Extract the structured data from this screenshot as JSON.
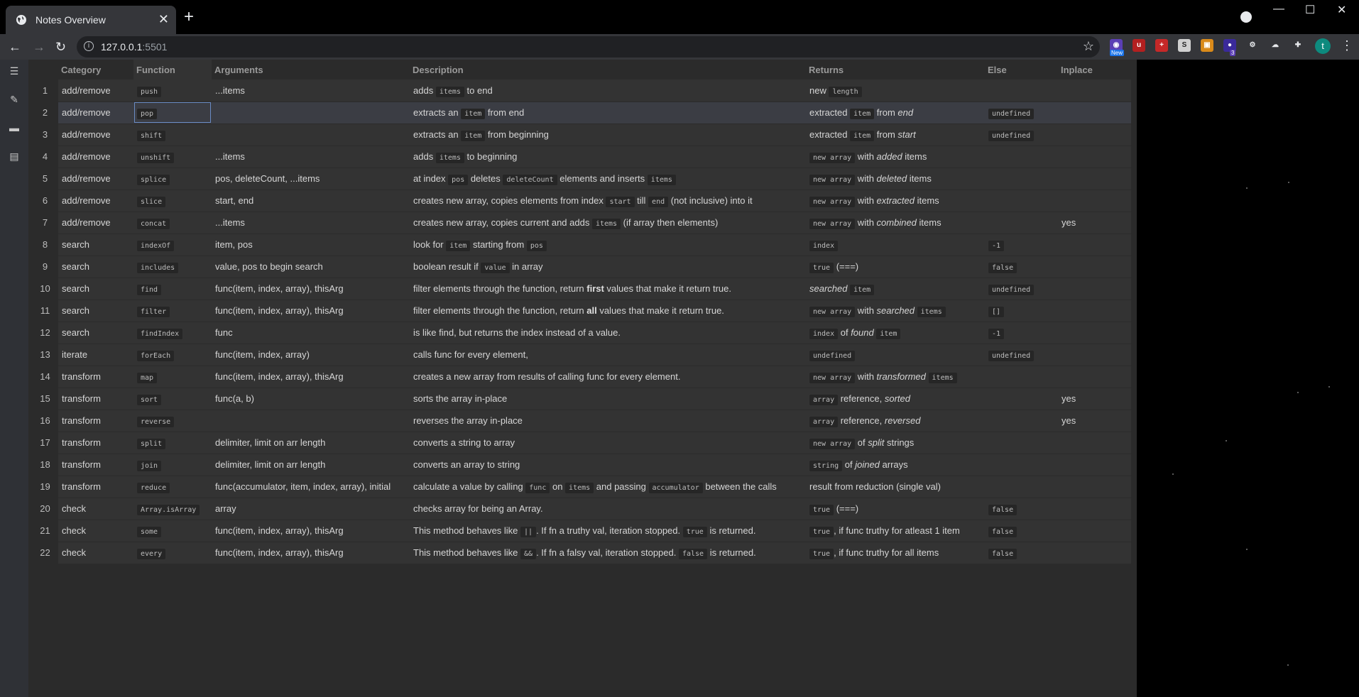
{
  "browser": {
    "tab_title": "Notes Overview",
    "url_host": "127.0.0.1",
    "url_port": ":5501",
    "ext_new_badge": "New",
    "ext_count_badge": "3",
    "profile_initial": "t"
  },
  "table": {
    "headers": [
      "Category",
      "Function",
      "Arguments",
      "Description",
      "Returns",
      "Else",
      "Inplace"
    ],
    "rows": [
      {
        "n": "1",
        "cat": "add/remove",
        "fn": "push",
        "args": "...items",
        "desc": [
          {
            "t": "adds "
          },
          {
            "c": "items"
          },
          {
            "t": " to end"
          }
        ],
        "ret": [
          {
            "t": "new "
          },
          {
            "c": "length"
          }
        ],
        "else": [],
        "inplace": ""
      },
      {
        "n": "2",
        "cat": "add/remove",
        "fn": "pop",
        "args": "",
        "desc": [
          {
            "t": "extracts an "
          },
          {
            "c": "item"
          },
          {
            "t": " from end"
          }
        ],
        "ret": [
          {
            "t": "extracted "
          },
          {
            "c": "item"
          },
          {
            "t": " from "
          },
          {
            "i": "end"
          }
        ],
        "else": [
          {
            "c": "undefined"
          }
        ],
        "inplace": ""
      },
      {
        "n": "3",
        "cat": "add/remove",
        "fn": "shift",
        "args": "",
        "desc": [
          {
            "t": "extracts an "
          },
          {
            "c": "item"
          },
          {
            "t": " from beginning"
          }
        ],
        "ret": [
          {
            "t": "extracted "
          },
          {
            "c": "item"
          },
          {
            "t": " from "
          },
          {
            "i": "start"
          }
        ],
        "else": [
          {
            "c": "undefined"
          }
        ],
        "inplace": ""
      },
      {
        "n": "4",
        "cat": "add/remove",
        "fn": "unshift",
        "args": "...items",
        "desc": [
          {
            "t": "adds "
          },
          {
            "c": "items"
          },
          {
            "t": " to beginning"
          }
        ],
        "ret": [
          {
            "c": "new array"
          },
          {
            "t": " with "
          },
          {
            "i": "added"
          },
          {
            "t": " items"
          }
        ],
        "else": [],
        "inplace": ""
      },
      {
        "n": "5",
        "cat": "add/remove",
        "fn": "splice",
        "args": "pos, deleteCount, ...items",
        "desc": [
          {
            "t": "at index "
          },
          {
            "c": "pos"
          },
          {
            "t": " deletes "
          },
          {
            "c": "deleteCount"
          },
          {
            "t": " elements and inserts "
          },
          {
            "c": "items"
          }
        ],
        "ret": [
          {
            "c": "new array"
          },
          {
            "t": " with "
          },
          {
            "i": "deleted"
          },
          {
            "t": " items"
          }
        ],
        "else": [],
        "inplace": ""
      },
      {
        "n": "6",
        "cat": "add/remove",
        "fn": "slice",
        "args": "start, end",
        "desc": [
          {
            "t": "creates new array, copies elements from index "
          },
          {
            "c": "start"
          },
          {
            "t": " till "
          },
          {
            "c": "end"
          },
          {
            "t": " (not inclusive) into it"
          }
        ],
        "ret": [
          {
            "c": "new array"
          },
          {
            "t": " with "
          },
          {
            "i": "extracted"
          },
          {
            "t": " items"
          }
        ],
        "else": [],
        "inplace": ""
      },
      {
        "n": "7",
        "cat": "add/remove",
        "fn": "concat",
        "args": "...items",
        "desc": [
          {
            "t": "creates new array, copies current and adds "
          },
          {
            "c": "items"
          },
          {
            "t": " (if array then elements)"
          }
        ],
        "ret": [
          {
            "c": "new array"
          },
          {
            "t": " with "
          },
          {
            "i": "combined"
          },
          {
            "t": " items"
          }
        ],
        "else": [],
        "inplace": "yes"
      },
      {
        "n": "8",
        "cat": "search",
        "fn": "indexOf",
        "args": "item, pos",
        "desc": [
          {
            "t": "look for "
          },
          {
            "c": "item"
          },
          {
            "t": " starting from "
          },
          {
            "c": "pos"
          }
        ],
        "ret": [
          {
            "c": "index"
          }
        ],
        "else": [
          {
            "c": "-1"
          }
        ],
        "inplace": ""
      },
      {
        "n": "9",
        "cat": "search",
        "fn": "includes",
        "args": "value, pos to begin search",
        "desc": [
          {
            "t": "boolean result if "
          },
          {
            "c": "value"
          },
          {
            "t": " in array"
          }
        ],
        "ret": [
          {
            "c": "true"
          },
          {
            "t": " (===)"
          }
        ],
        "else": [
          {
            "c": "false"
          }
        ],
        "inplace": ""
      },
      {
        "n": "10",
        "cat": "search",
        "fn": "find",
        "args": "func(item, index, array), thisArg",
        "desc": [
          {
            "t": "filter elements through the function, return "
          },
          {
            "b": "first"
          },
          {
            "t": " values that make it return true."
          }
        ],
        "ret": [
          {
            "i": "searched"
          },
          {
            "t": " "
          },
          {
            "c": "item"
          }
        ],
        "else": [
          {
            "c": "undefined"
          }
        ],
        "inplace": ""
      },
      {
        "n": "11",
        "cat": "search",
        "fn": "filter",
        "args": "func(item, index, array), thisArg",
        "desc": [
          {
            "t": "filter elements through the function, return "
          },
          {
            "b": "all"
          },
          {
            "t": " values that make it return true."
          }
        ],
        "ret": [
          {
            "c": "new array"
          },
          {
            "t": " with "
          },
          {
            "i": "searched"
          },
          {
            "t": " "
          },
          {
            "c": "items"
          }
        ],
        "else": [
          {
            "c": "[]"
          }
        ],
        "inplace": ""
      },
      {
        "n": "12",
        "cat": "search",
        "fn": "findIndex",
        "args": "func",
        "desc": [
          {
            "t": "is like find, but returns the index instead of a value."
          }
        ],
        "ret": [
          {
            "c": "index"
          },
          {
            "t": " of "
          },
          {
            "i": "found"
          },
          {
            "t": " "
          },
          {
            "c": "item"
          }
        ],
        "else": [
          {
            "c": "-1"
          }
        ],
        "inplace": ""
      },
      {
        "n": "13",
        "cat": "iterate",
        "fn": "forEach",
        "args": "func(item, index, array)",
        "desc": [
          {
            "t": "calls func for every element,"
          }
        ],
        "ret": [
          {
            "c": "undefined"
          }
        ],
        "else": [
          {
            "c": "undefined"
          }
        ],
        "inplace": ""
      },
      {
        "n": "14",
        "cat": "transform",
        "fn": "map",
        "args": "func(item, index, array), thisArg",
        "desc": [
          {
            "t": "creates a new array from results of calling func for every element."
          }
        ],
        "ret": [
          {
            "c": "new array"
          },
          {
            "t": " with "
          },
          {
            "i": "transformed"
          },
          {
            "t": " "
          },
          {
            "c": "items"
          }
        ],
        "else": [],
        "inplace": ""
      },
      {
        "n": "15",
        "cat": "transform",
        "fn": "sort",
        "args": "func(a, b)",
        "desc": [
          {
            "t": "sorts the array in-place"
          }
        ],
        "ret": [
          {
            "c": "array"
          },
          {
            "t": " reference, "
          },
          {
            "i": "sorted"
          }
        ],
        "else": [],
        "inplace": "yes"
      },
      {
        "n": "16",
        "cat": "transform",
        "fn": "reverse",
        "args": "",
        "desc": [
          {
            "t": "reverses the array in-place"
          }
        ],
        "ret": [
          {
            "c": "array"
          },
          {
            "t": " reference, "
          },
          {
            "i": "reversed"
          }
        ],
        "else": [],
        "inplace": "yes"
      },
      {
        "n": "17",
        "cat": "transform",
        "fn": "split",
        "args": "delimiter, limit on arr length",
        "desc": [
          {
            "t": "converts a string to array"
          }
        ],
        "ret": [
          {
            "c": "new array"
          },
          {
            "t": " of "
          },
          {
            "i": "split"
          },
          {
            "t": " strings"
          }
        ],
        "else": [],
        "inplace": ""
      },
      {
        "n": "18",
        "cat": "transform",
        "fn": "join",
        "args": "delimiter, limit on arr length",
        "desc": [
          {
            "t": "converts an array to string"
          }
        ],
        "ret": [
          {
            "c": "string"
          },
          {
            "t": " of "
          },
          {
            "i": "joined"
          },
          {
            "t": " arrays"
          }
        ],
        "else": [],
        "inplace": ""
      },
      {
        "n": "19",
        "cat": "transform",
        "fn": "reduce",
        "args": "func(accumulator, item, index, array), initial",
        "desc": [
          {
            "t": "calculate a value by calling "
          },
          {
            "c": "func"
          },
          {
            "t": " on "
          },
          {
            "c": "items"
          },
          {
            "t": " and passing "
          },
          {
            "c": "accumulator"
          },
          {
            "t": " between the calls"
          }
        ],
        "ret": [
          {
            "t": "result from reduction (single val)"
          }
        ],
        "else": [],
        "inplace": ""
      },
      {
        "n": "20",
        "cat": "check",
        "fn": "Array.isArray",
        "args": "array",
        "desc": [
          {
            "t": "checks array for being an Array."
          }
        ],
        "ret": [
          {
            "c": "true"
          },
          {
            "t": " (===)"
          }
        ],
        "else": [
          {
            "c": "false"
          }
        ],
        "inplace": ""
      },
      {
        "n": "21",
        "cat": "check",
        "fn": "some",
        "args": "func(item, index, array), thisArg",
        "desc": [
          {
            "t": "This method behaves like "
          },
          {
            "c": "||"
          },
          {
            "t": ". If fn a truthy val, iteration stopped. "
          },
          {
            "c": "true"
          },
          {
            "t": " is returned."
          }
        ],
        "ret": [
          {
            "c": "true"
          },
          {
            "t": ", if func truthy for atleast 1 item"
          }
        ],
        "else": [
          {
            "c": "false"
          }
        ],
        "inplace": ""
      },
      {
        "n": "22",
        "cat": "check",
        "fn": "every",
        "args": "func(item, index, array), thisArg",
        "desc": [
          {
            "t": "This method behaves like "
          },
          {
            "c": "&&"
          },
          {
            "t": ". If fn a falsy val, iteration stopped. "
          },
          {
            "c": "false"
          },
          {
            "t": " is returned."
          }
        ],
        "ret": [
          {
            "c": "true"
          },
          {
            "t": ", if func truthy for all items"
          }
        ],
        "else": [
          {
            "c": "false"
          }
        ],
        "inplace": ""
      }
    ]
  },
  "icons": {
    "tab": "globe-icon",
    "sidebar": [
      "menu-icon",
      "edit-icon",
      "keyboard-icon",
      "document-icon"
    ]
  },
  "colors": {
    "page_bg": "#2b2b2b",
    "row_bg": "#333333",
    "selected_row_bg": "#3b3d44",
    "selection_outline": "#6a8bc4",
    "profile_bg": "#0d8a7e"
  }
}
